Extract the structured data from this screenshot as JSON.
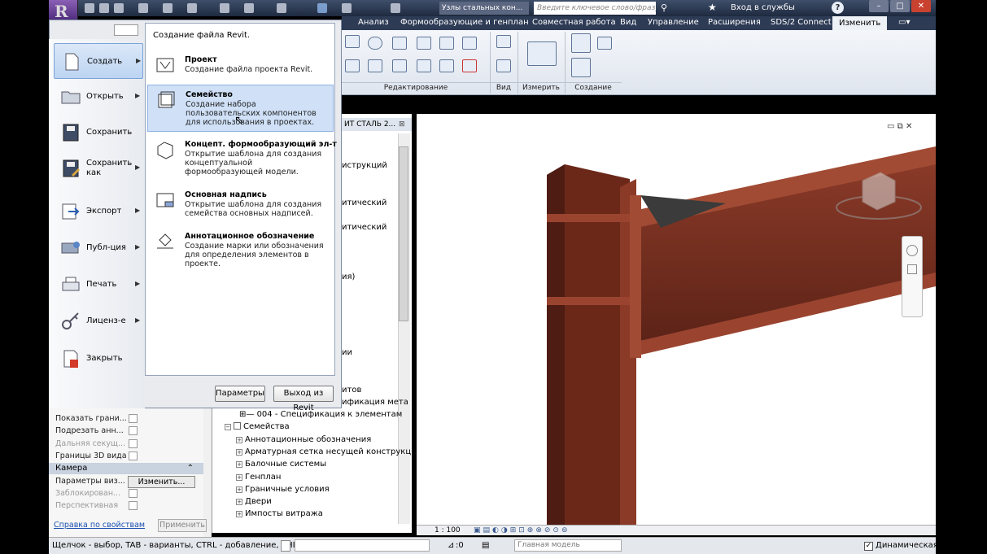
{
  "quick_access": {
    "doc_title": "Узлы стальных кон...",
    "search_placeholder": "Введите ключевое слово/фразу",
    "signin_label": "Вход в службы"
  },
  "ribbon": {
    "tabs": [
      "Анализ",
      "Формообразующие и генплан",
      "Совместная работа",
      "Вид",
      "Управление",
      "Расширения",
      "SDS/2 Connect",
      "Изменить"
    ],
    "active_tab": "Изменить",
    "groups": [
      "Редактирование",
      "Вид",
      "Измерить",
      "Создание"
    ]
  },
  "app_menu": {
    "items": [
      {
        "label": "Создать",
        "has_submenu": true
      },
      {
        "label": "Открыть",
        "has_submenu": true
      },
      {
        "label": "Сохранить",
        "has_submenu": false
      },
      {
        "label": "Сохранить как",
        "has_submenu": true
      },
      {
        "label": "Экспорт",
        "has_submenu": true
      },
      {
        "label": "Публ-ция",
        "has_submenu": true
      },
      {
        "label": "Печать",
        "has_submenu": true
      },
      {
        "label": "Лиценз-е",
        "has_submenu": true
      },
      {
        "label": "Закрыть",
        "has_submenu": false
      }
    ],
    "submenu_title": "Создание файла Revit.",
    "submenu_items": [
      {
        "title": "Проект",
        "desc": "Создание файла проекта Revit."
      },
      {
        "title": "Семейство",
        "desc": "Создание набора пользовательских компонентов для использования в проектах."
      },
      {
        "title": "Концепт. формообразующий эл-т",
        "desc": "Открытие шаблона для создания концептуальной формообразующей модели."
      },
      {
        "title": "Основная надпись",
        "desc": "Открытие шаблона для создания семейства основных надписей."
      },
      {
        "title": "Аннотационное обозначение",
        "desc": "Создание марки или обозначения для определения элементов в проекте."
      }
    ],
    "options_button": "Параметры",
    "exit_button": "Выход из Revit"
  },
  "project_browser": {
    "header": "ИТ СТАЛЬ 2...",
    "partial_items": [
      "иструкций",
      "итический",
      "итический",
      "ия)",
      "ии",
      "итов",
      "ификация мета"
    ],
    "schedule_item": "004 - Спецификация к элементам",
    "families_label": "Семейства",
    "families": [
      "Аннотационные обозначения",
      "Арматурная сетка несущей конструкц",
      "Балочные системы",
      "Генплан",
      "Граничные условия",
      "Двери",
      "Импосты витража"
    ]
  },
  "properties": {
    "rows": [
      {
        "label": "Показать грани...",
        "disabled": false
      },
      {
        "label": "Подрезать анн...",
        "disabled": false
      },
      {
        "label": "Дальняя секущ...",
        "disabled": true
      },
      {
        "label": "Границы 3D вида",
        "disabled": false
      }
    ],
    "camera_header": "Камера",
    "camera_rows": [
      {
        "label": "Параметры виз...",
        "disabled": false
      },
      {
        "label": "Заблокирован...",
        "disabled": true
      },
      {
        "label": "Перспективная",
        "disabled": true
      }
    ],
    "edit_button": "Изменить...",
    "help_link": "Справка по свойствам",
    "apply_button": "Применить"
  },
  "view_bar": {
    "scale": "1 : 100"
  },
  "status_bar": {
    "hint": "Щелчок - выбор, TAB - варианты, CTRL - добавление, SHIF",
    "zero": ":0",
    "model": "Главная модель",
    "dynamic": "Динамическая р"
  },
  "colors": {
    "steel": "#7a2f1f",
    "steel_dark": "#4e1c12",
    "ribbon_tab_bg": "#2d3b55",
    "app_button": "#6a3f99"
  }
}
